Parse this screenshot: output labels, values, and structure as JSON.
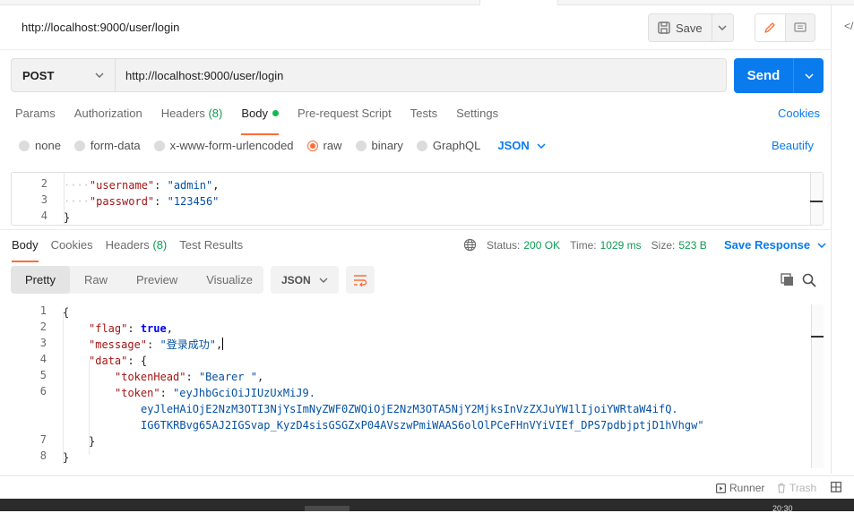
{
  "header": {
    "title": "http://localhost:9000/user/login",
    "save_label": "Save"
  },
  "request": {
    "method": "POST",
    "url": "http://localhost:9000/user/login",
    "send_label": "Send"
  },
  "request_tabs": {
    "params": "Params",
    "authorization": "Authorization",
    "headers": "Headers",
    "headers_count": "(8)",
    "body": "Body",
    "pre_request": "Pre-request Script",
    "tests": "Tests",
    "settings": "Settings",
    "cookies": "Cookies"
  },
  "body_types": {
    "none": "none",
    "form_data": "form-data",
    "urlencoded": "x-www-form-urlencoded",
    "raw": "raw",
    "binary": "binary",
    "graphql": "GraphQL",
    "format": "JSON",
    "beautify": "Beautify",
    "selected": "raw"
  },
  "request_body": {
    "lines": [
      {
        "num": "2",
        "key": "\"username\"",
        "value": "\"admin\"",
        "tail": ","
      },
      {
        "num": "3",
        "key": "\"password\"",
        "value": "\"123456\"",
        "tail": ""
      },
      {
        "num": "4",
        "text": "}"
      }
    ]
  },
  "response_tabs": {
    "body": "Body",
    "cookies": "Cookies",
    "headers": "Headers",
    "headers_count": "(8)",
    "test_results": "Test Results"
  },
  "response_meta": {
    "status_label": "Status:",
    "status_value": "200 OK",
    "time_label": "Time:",
    "time_value": "1029 ms",
    "size_label": "Size:",
    "size_value": "523 B",
    "save_response": "Save Response"
  },
  "response_view": {
    "pretty": "Pretty",
    "raw": "Raw",
    "preview": "Preview",
    "visualize": "Visualize",
    "format": "JSON"
  },
  "response_body": {
    "line_numbers": [
      "1",
      "2",
      "3",
      "4",
      "5",
      "6",
      "7",
      "8"
    ],
    "open_brace": "{",
    "flag_key": "\"flag\"",
    "flag_value": "true",
    "message_key": "\"message\"",
    "message_value": "\"登录成功\"",
    "data_key": "\"data\"",
    "data_open": "{",
    "token_head_key": "\"tokenHead\"",
    "token_head_value": "\"Bearer \"",
    "token_key": "\"token\"",
    "token_line1": "\"eyJhbGciOiJIUzUxMiJ9.",
    "token_line2": "eyJleHAiOjE2NzM3OTI3NjYsImNyZWF0ZWQiOjE2NzM3OTA5NjY2MjksInVzZXJuYW1lIjoiYWRtaW4ifQ.",
    "token_line3": "IG6TKRBvg65AJ2IGSvap_KyzD4sisGSGZxP04AVszwPmiWAAS6olOlPCeFHnVYiVIEf_DPS7pdbjptjD1hVhgw\"",
    "data_close": "}",
    "close_brace": "}"
  },
  "status_bar": {
    "runner": "Runner",
    "trash": "Trash"
  },
  "taskbar": {
    "clock": "20:30"
  },
  "right_rail": {
    "code_label": "</"
  },
  "colors": {
    "accent_orange": "#ff6c37",
    "primary_blue": "#097bed",
    "status_green": "#0e9b52"
  }
}
